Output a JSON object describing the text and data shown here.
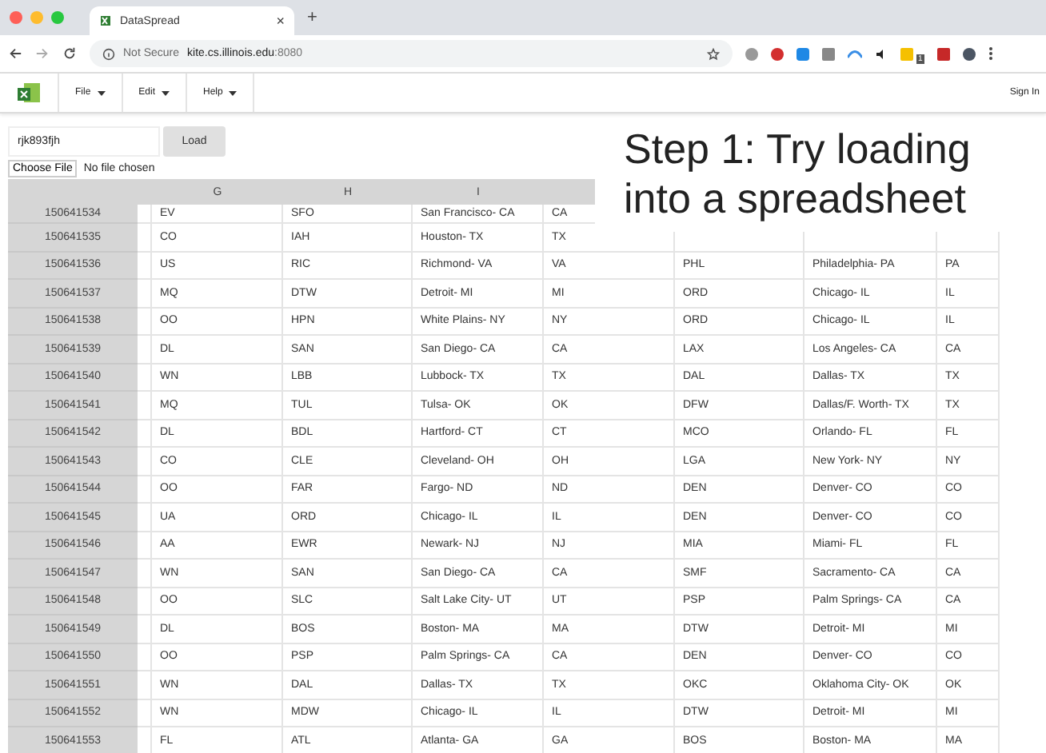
{
  "browser": {
    "tab_title": "DataSpread",
    "new_tab": "+",
    "close_tab": "×",
    "security": "Not Secure",
    "url_host": "kite.cs.illinois.edu",
    "url_port": ":8080",
    "extension_badge": "1"
  },
  "toolbar": {
    "menus": [
      {
        "label": "File"
      },
      {
        "label": "Edit"
      },
      {
        "label": "Help"
      }
    ],
    "sign_in": "Sign In"
  },
  "load_form": {
    "value": "rjk893fjh",
    "button": "Load",
    "file_button": "Choose File",
    "file_status": "No file chosen"
  },
  "callout": "Step 1: Try loading into a spreadsheet",
  "sheet": {
    "columns": [
      "G",
      "H",
      "I"
    ],
    "rows": [
      {
        "id": "150641534",
        "cells": [
          "EV",
          "SFO",
          "San Francisco- CA",
          "CA"
        ]
      },
      {
        "id": "150641535",
        "cells": [
          "CO",
          "IAH",
          "Houston- TX",
          "TX"
        ]
      },
      {
        "id": "150641536",
        "cells": [
          "US",
          "RIC",
          "Richmond- VA",
          "VA",
          "PHL",
          "Philadelphia- PA",
          "PA"
        ]
      },
      {
        "id": "150641537",
        "cells": [
          "MQ",
          "DTW",
          "Detroit- MI",
          "MI",
          "ORD",
          "Chicago- IL",
          "IL"
        ]
      },
      {
        "id": "150641538",
        "cells": [
          "OO",
          "HPN",
          "White Plains- NY",
          "NY",
          "ORD",
          "Chicago- IL",
          "IL"
        ]
      },
      {
        "id": "150641539",
        "cells": [
          "DL",
          "SAN",
          "San Diego- CA",
          "CA",
          "LAX",
          "Los Angeles- CA",
          "CA"
        ]
      },
      {
        "id": "150641540",
        "cells": [
          "WN",
          "LBB",
          "Lubbock- TX",
          "TX",
          "DAL",
          "Dallas- TX",
          "TX"
        ]
      },
      {
        "id": "150641541",
        "cells": [
          "MQ",
          "TUL",
          "Tulsa- OK",
          "OK",
          "DFW",
          "Dallas/F. Worth- TX",
          "TX"
        ]
      },
      {
        "id": "150641542",
        "cells": [
          "DL",
          "BDL",
          "Hartford- CT",
          "CT",
          "MCO",
          "Orlando- FL",
          "FL"
        ]
      },
      {
        "id": "150641543",
        "cells": [
          "CO",
          "CLE",
          "Cleveland- OH",
          "OH",
          "LGA",
          "New York- NY",
          "NY"
        ]
      },
      {
        "id": "150641544",
        "cells": [
          "OO",
          "FAR",
          "Fargo- ND",
          "ND",
          "DEN",
          "Denver- CO",
          "CO"
        ]
      },
      {
        "id": "150641545",
        "cells": [
          "UA",
          "ORD",
          "Chicago- IL",
          "IL",
          "DEN",
          "Denver- CO",
          "CO"
        ]
      },
      {
        "id": "150641546",
        "cells": [
          "AA",
          "EWR",
          "Newark- NJ",
          "NJ",
          "MIA",
          "Miami- FL",
          "FL"
        ]
      },
      {
        "id": "150641547",
        "cells": [
          "WN",
          "SAN",
          "San Diego- CA",
          "CA",
          "SMF",
          "Sacramento- CA",
          "CA"
        ]
      },
      {
        "id": "150641548",
        "cells": [
          "OO",
          "SLC",
          "Salt Lake City- UT",
          "UT",
          "PSP",
          "Palm Springs- CA",
          "CA"
        ]
      },
      {
        "id": "150641549",
        "cells": [
          "DL",
          "BOS",
          "Boston- MA",
          "MA",
          "DTW",
          "Detroit- MI",
          "MI"
        ]
      },
      {
        "id": "150641550",
        "cells": [
          "OO",
          "PSP",
          "Palm Springs- CA",
          "CA",
          "DEN",
          "Denver- CO",
          "CO"
        ]
      },
      {
        "id": "150641551",
        "cells": [
          "WN",
          "DAL",
          "Dallas- TX",
          "TX",
          "OKC",
          "Oklahoma City- OK",
          "OK"
        ]
      },
      {
        "id": "150641552",
        "cells": [
          "WN",
          "MDW",
          "Chicago- IL",
          "IL",
          "DTW",
          "Detroit- MI",
          "MI"
        ]
      },
      {
        "id": "150641553",
        "cells": [
          "FL",
          "ATL",
          "Atlanta- GA",
          "GA",
          "BOS",
          "Boston- MA",
          "MA"
        ]
      }
    ]
  }
}
